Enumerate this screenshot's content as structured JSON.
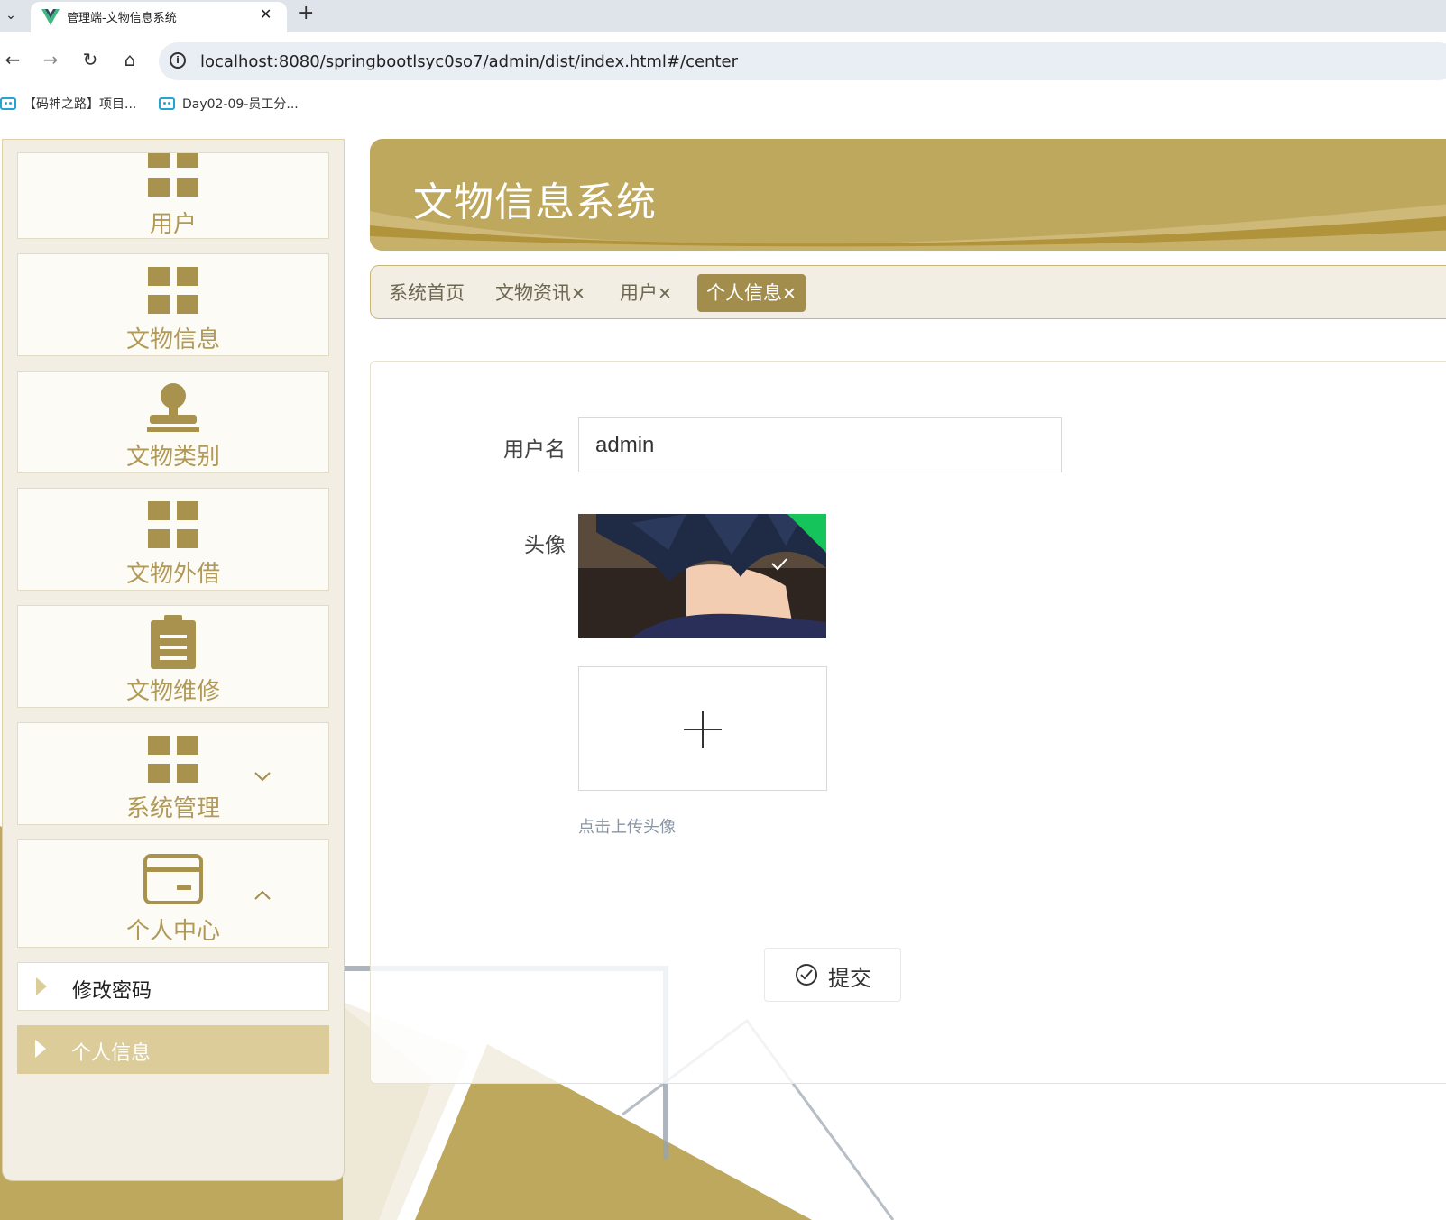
{
  "browser": {
    "tab_title": "管理端-文物信息系统",
    "url": "localhost:8080/springbootlsyc0so7/admin/dist/index.html#/center",
    "bookmarks": [
      "【码神之路】项目...",
      "Day02-09-员工分..."
    ]
  },
  "colors": {
    "accent": "#bea85d",
    "accent_dark": "#a38d4d",
    "sidebar_bg": "#f3eee3",
    "menu_text": "#b19a57"
  },
  "sidebar": {
    "items": [
      {
        "label": "用户",
        "icon": "grid-icon"
      },
      {
        "label": "文物信息",
        "icon": "grid-icon"
      },
      {
        "label": "文物类别",
        "icon": "user-icon"
      },
      {
        "label": "文物外借",
        "icon": "grid-icon"
      },
      {
        "label": "文物维修",
        "icon": "clipboard-icon"
      },
      {
        "label": "系统管理",
        "icon": "grid-icon",
        "expanded": false
      },
      {
        "label": "个人中心",
        "icon": "wallet-icon",
        "expanded": true
      }
    ],
    "submenu": [
      {
        "label": "修改密码",
        "active": false
      },
      {
        "label": "个人信息",
        "active": true
      }
    ]
  },
  "header": {
    "title": "文物信息系统"
  },
  "tags": [
    {
      "label": "系统首页",
      "closable": false,
      "active": false
    },
    {
      "label": "文物资讯",
      "closable": true,
      "active": false
    },
    {
      "label": "用户",
      "closable": true,
      "active": false
    },
    {
      "label": "个人信息",
      "closable": true,
      "active": true
    }
  ],
  "form": {
    "username_label": "用户名",
    "username_value": "admin",
    "avatar_label": "头像",
    "upload_hint": "点击上传头像",
    "submit_label": "提交"
  }
}
